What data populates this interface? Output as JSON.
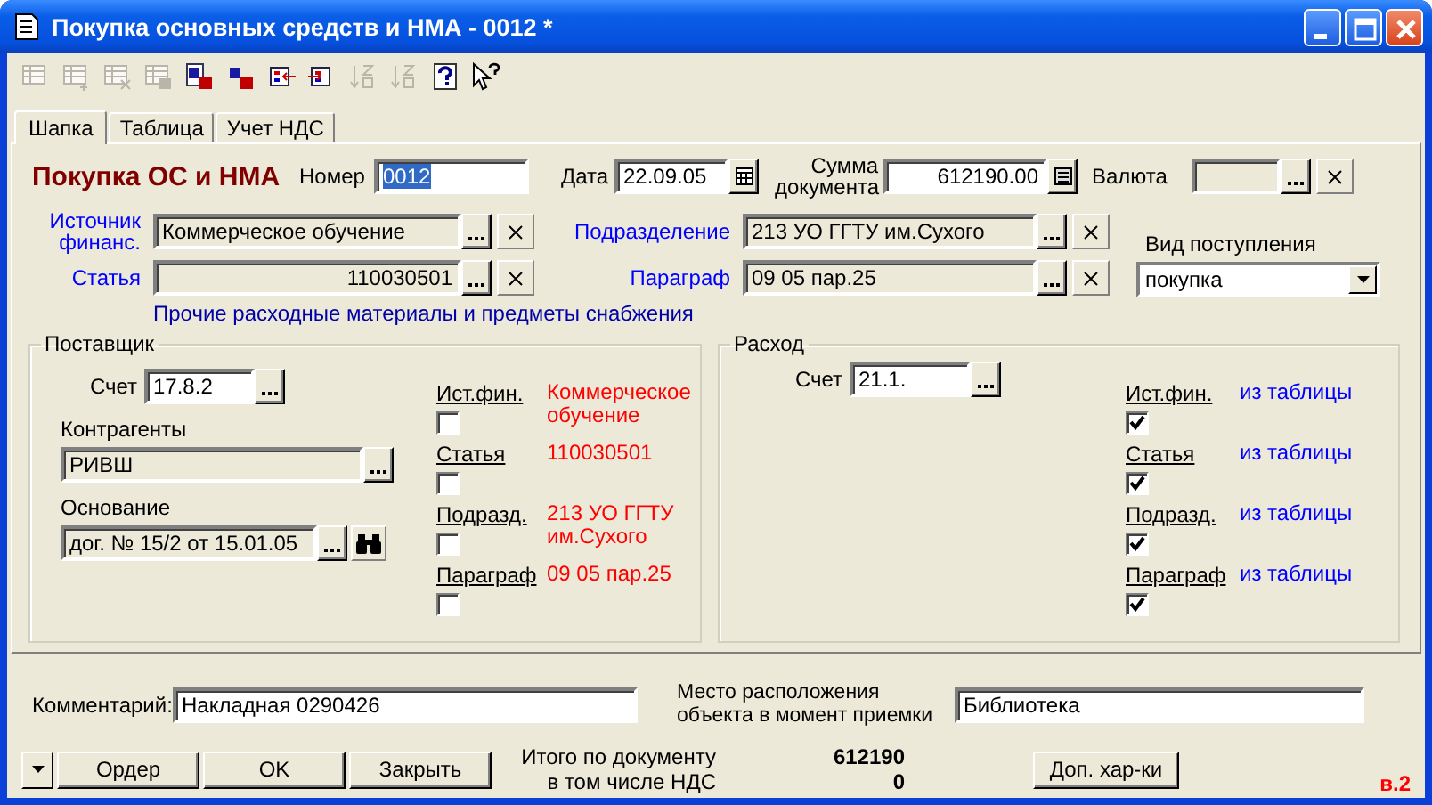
{
  "window": {
    "title": "Покупка основных средств и НМА - 0012 *"
  },
  "toolbar": [
    {
      "kind": "grid",
      "disabled": true
    },
    {
      "kind": "grid-add",
      "disabled": true
    },
    {
      "kind": "grid-delete",
      "disabled": true
    },
    {
      "kind": "grid-copy",
      "disabled": true
    },
    {
      "kind": "entry-red",
      "disabled": false
    },
    {
      "kind": "entry",
      "disabled": false
    },
    {
      "kind": "columns-left",
      "disabled": false
    },
    {
      "kind": "columns-right",
      "disabled": false
    },
    {
      "kind": "sort-asc",
      "disabled": true
    },
    {
      "kind": "sort-desc",
      "disabled": true
    },
    {
      "kind": "help",
      "disabled": false
    },
    {
      "kind": "whats-this",
      "disabled": false
    }
  ],
  "tabs": [
    {
      "label": "Шапка",
      "selected": true
    },
    {
      "label": "Таблица",
      "selected": false
    },
    {
      "label": "Учет НДС",
      "selected": false
    }
  ],
  "header": {
    "title": "Покупка ОС и НМА",
    "number": {
      "label": "Номер",
      "value": "0012",
      "highlighted": true
    },
    "date": {
      "label": "Дата",
      "value": "22.09.05"
    },
    "sum": {
      "label": "Сумма документа",
      "value": "612190.00"
    },
    "currency": {
      "label": "Валюта"
    }
  },
  "refs": {
    "rows": [
      {
        "label": "Источник финанс.",
        "value": "Коммерческое обучение",
        "kind": "text"
      },
      {
        "label": "Подразделение",
        "value": "213 УО ГГТУ им.Сухого",
        "kind": "text"
      },
      {
        "label": "Статья",
        "value": "110030501",
        "kind": "code"
      },
      {
        "label": "Параграф",
        "value": "09 05 пар.25",
        "kind": "text"
      }
    ],
    "receipt_type": {
      "label": "Вид поступления",
      "value": "покупка"
    },
    "article_name": "Прочие расходные материалы и предметы снабжения"
  },
  "supplier": {
    "title": "Поставщик",
    "account": {
      "label": "Счет",
      "value": "17.8.2"
    },
    "counterparty": {
      "label": "Контрагенты",
      "value": "РИВШ"
    },
    "basis": {
      "label": "Основание",
      "value": "дог. № 15/2 от 15.01.05"
    },
    "flags": [
      {
        "label": "Ист.фин.",
        "checked": false,
        "value": "Коммерческое обучение"
      },
      {
        "label": "Статья",
        "checked": false,
        "value": "110030501"
      },
      {
        "label": "Подразд.",
        "checked": false,
        "value": "213 УО ГГТУ им.Сухого"
      },
      {
        "label": "Параграф",
        "checked": false,
        "value": "09 05 пар.25"
      }
    ]
  },
  "expense": {
    "title": "Расход",
    "account": {
      "label": "Счет",
      "value": "21.1."
    },
    "flags": [
      {
        "label": "Ист.фин.",
        "checked": true,
        "value": "из таблицы"
      },
      {
        "label": "Статья",
        "checked": true,
        "value": "из таблицы"
      },
      {
        "label": "Подразд.",
        "checked": true,
        "value": "из таблицы"
      },
      {
        "label": "Параграф",
        "checked": true,
        "value": "из таблицы"
      }
    ]
  },
  "comment": {
    "label": "Комментарий:",
    "value": "Накладная 0290426"
  },
  "location": {
    "label": "Место расположения объекта в момент приемки",
    "value": "Библиотека"
  },
  "buttons": [
    "Ордер",
    "OK",
    "Закрыть"
  ],
  "totals": [
    {
      "label": "Итого по документу",
      "value": "612190"
    },
    {
      "label": "в том числе НДС",
      "value": "0"
    }
  ],
  "extra_button": "Доп. хар-ки",
  "version": "в.2"
}
